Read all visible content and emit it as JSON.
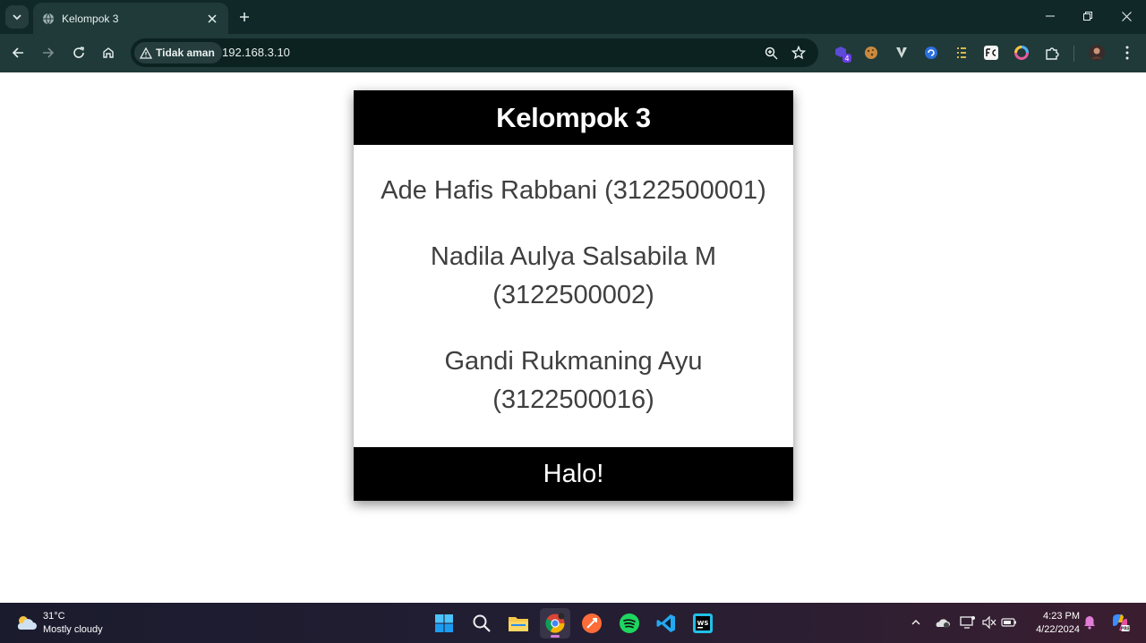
{
  "browser": {
    "tab_title": "Kelompok 3",
    "security_chip": "Tidak aman",
    "url": "192.168.3.10",
    "extension_badge": "4"
  },
  "page": {
    "header": "Kelompok 3",
    "members": [
      {
        "line1": "Ade Hafis Rabbani (3122500001)",
        "line2": ""
      },
      {
        "line1": "Nadila Aulya Salsabila M",
        "line2": "(3122500002)"
      },
      {
        "line1": "Gandi Rukmaning Ayu",
        "line2": "(3122500016)"
      }
    ],
    "footer": "Halo!"
  },
  "taskbar": {
    "weather_temp": "31°C",
    "weather_desc": "Mostly cloudy",
    "time": "4:23 PM",
    "date": "4/22/2024"
  },
  "colors": {
    "chrome_dark": "#112828",
    "chrome_toolbar": "#1f3a39",
    "card_band": "#000000",
    "card_text": "#3f3f3f"
  }
}
